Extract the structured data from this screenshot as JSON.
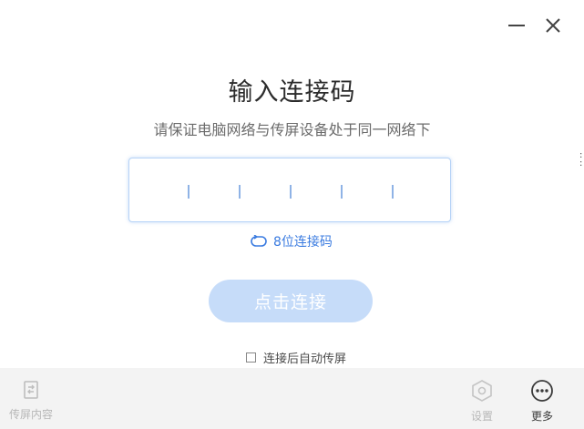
{
  "window": {
    "minimize_icon": "minimize-icon",
    "close_icon": "close-icon"
  },
  "main": {
    "title": "输入连接码",
    "subtitle": "请保证电脑网络与传屏设备处于同一网络下",
    "code_input": {
      "slot_count": 6,
      "value": ""
    },
    "code_length_toggle": {
      "icon": "switch-icon",
      "label": "8位连接码"
    },
    "connect_button": {
      "label": "点击连接",
      "state": "disabled"
    },
    "auto_cast_option": {
      "label": "连接后自动传屏",
      "checked": false
    }
  },
  "bottom_bar": {
    "cast_content": {
      "icon": "cast-screen-icon",
      "label": "传屏内容"
    },
    "settings": {
      "icon": "gear-hexagon-icon",
      "label": "设置"
    },
    "more": {
      "icon": "more-dots-icon",
      "label": "更多"
    }
  },
  "colors": {
    "accent": "#3a7be0",
    "button_disabled_bg": "#c6dcf9",
    "input_border": "#b6d3f7",
    "bottom_bar_bg": "#f3f3f3"
  }
}
